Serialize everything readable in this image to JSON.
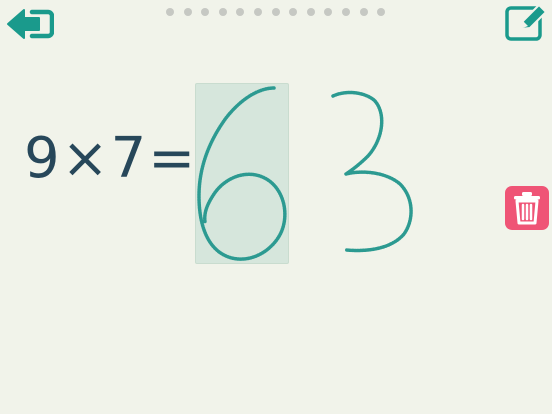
{
  "colors": {
    "background": "#f1f3ea",
    "accent": "#1a9a8c",
    "equation_text": "#27475a",
    "answer_text": "#e4242a",
    "ink": "#2c9a91",
    "active_box": "#d6e6dc",
    "progress_dot": "#c6c8c3",
    "trash_button": "#ef5476"
  },
  "icons": {
    "back": "exit-arrow-icon",
    "edit": "pencil-edit-icon",
    "trash": "trash-icon"
  },
  "progress": {
    "total_steps": 13
  },
  "equation": {
    "operand_a": "9",
    "operator": "×",
    "operand_b": "7",
    "equals": "=",
    "answer_entered": "6"
  },
  "handwriting": {
    "digits": [
      "6",
      "3"
    ],
    "active_index": 0
  }
}
